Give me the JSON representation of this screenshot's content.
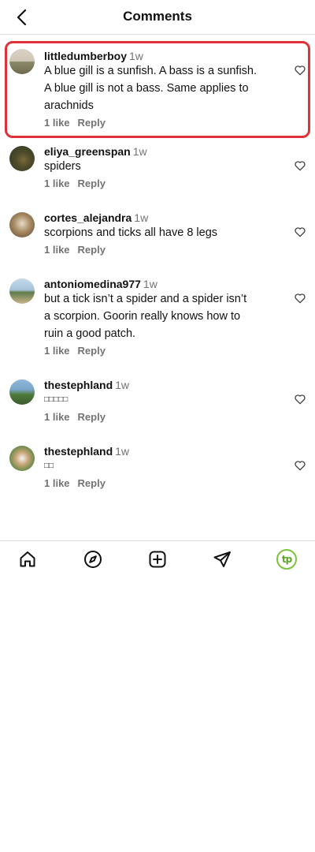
{
  "header": {
    "title": "Comments",
    "back_icon": "chevron-left-icon"
  },
  "comments": [
    {
      "username": "littledumberboy",
      "time": "1w",
      "lines": [
        "A blue gill is a sunfish. A bass is a sunfish.",
        "A blue gill is not a bass. Same applies to",
        "arachnids"
      ],
      "likes": "1 like",
      "reply": "Reply",
      "highlighted": true
    },
    {
      "username": "eliya_greenspan",
      "time": "1w",
      "lines": [
        "spiders"
      ],
      "likes": "1 like",
      "reply": "Reply"
    },
    {
      "username": "cortes_alejandra",
      "time": "1w",
      "lines": [
        "scorpions and ticks all have 8 legs"
      ],
      "likes": "1 like",
      "reply": "Reply"
    },
    {
      "username": "antoniomedina977",
      "time": "1w",
      "lines": [
        "but a tick isn’t a spider and a spider isn’t",
        "a scorpion. Goorin really knows how to",
        "ruin a good patch."
      ],
      "likes": "1 like",
      "reply": "Reply"
    },
    {
      "username": "thestephland",
      "time": "1w",
      "lines": [
        "□□□□□"
      ],
      "likes": "1 like",
      "reply": "Reply"
    },
    {
      "username": "thestephland",
      "time": "1w",
      "lines": [
        "□□"
      ],
      "likes": "1 like",
      "reply": "Reply"
    }
  ],
  "bottom_nav": {
    "items": [
      "home-icon",
      "explore-icon",
      "create-icon",
      "send-icon",
      "profile-avatar"
    ],
    "profile_initials": "tp"
  },
  "colors": {
    "highlight_border": "#e0303a",
    "muted_text": "#737373",
    "profile_ring": "#7cc23a"
  }
}
